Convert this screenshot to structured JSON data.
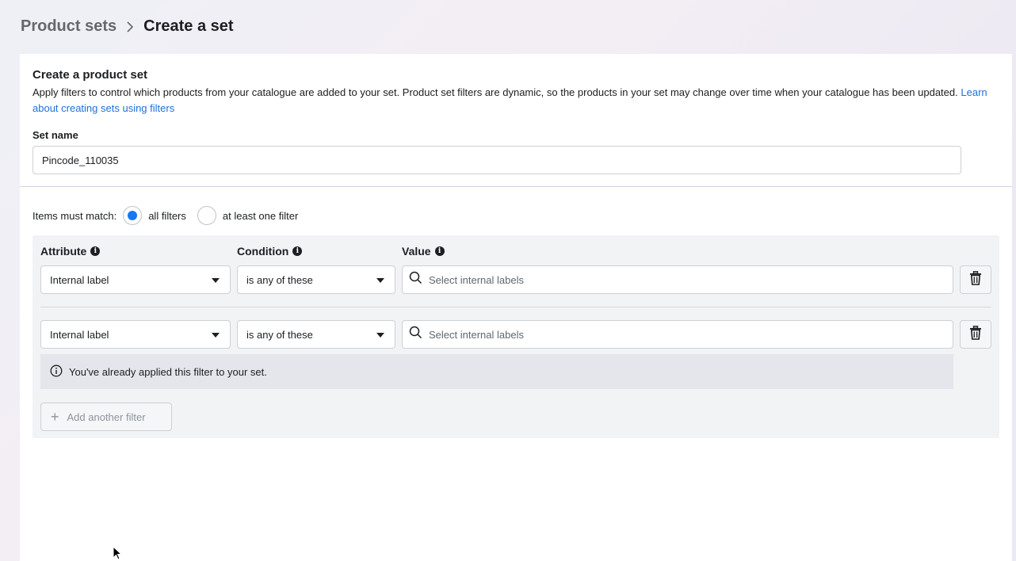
{
  "breadcrumb": {
    "parent": "Product sets",
    "current": "Create a set"
  },
  "form": {
    "title": "Create a product set",
    "description": "Apply filters to control which products from your catalogue are added to your set. Product set filters are dynamic, so the products in your set may change over time when your catalogue has been updated.",
    "learn_link": "Learn about creating sets using filters",
    "set_name_label": "Set name",
    "set_name_value": "Pincode_110035"
  },
  "match": {
    "label": "Items must match:",
    "options": [
      {
        "label": "all filters",
        "selected": true
      },
      {
        "label": "at least one filter",
        "selected": false
      }
    ]
  },
  "filters": {
    "headers": {
      "attribute": "Attribute",
      "condition": "Condition",
      "value": "Value"
    },
    "rows": [
      {
        "attribute": "Internal label",
        "condition": "is any of these",
        "value_placeholder": "Select internal labels"
      },
      {
        "attribute": "Internal label",
        "condition": "is any of these",
        "value_placeholder": "Select internal labels"
      }
    ],
    "duplicate_notice": "You've already applied this filter to your set.",
    "add_button": "Add another filter"
  },
  "colors": {
    "accent": "#1877f2",
    "link": "#216fdb",
    "panel": "#f2f3f5"
  }
}
